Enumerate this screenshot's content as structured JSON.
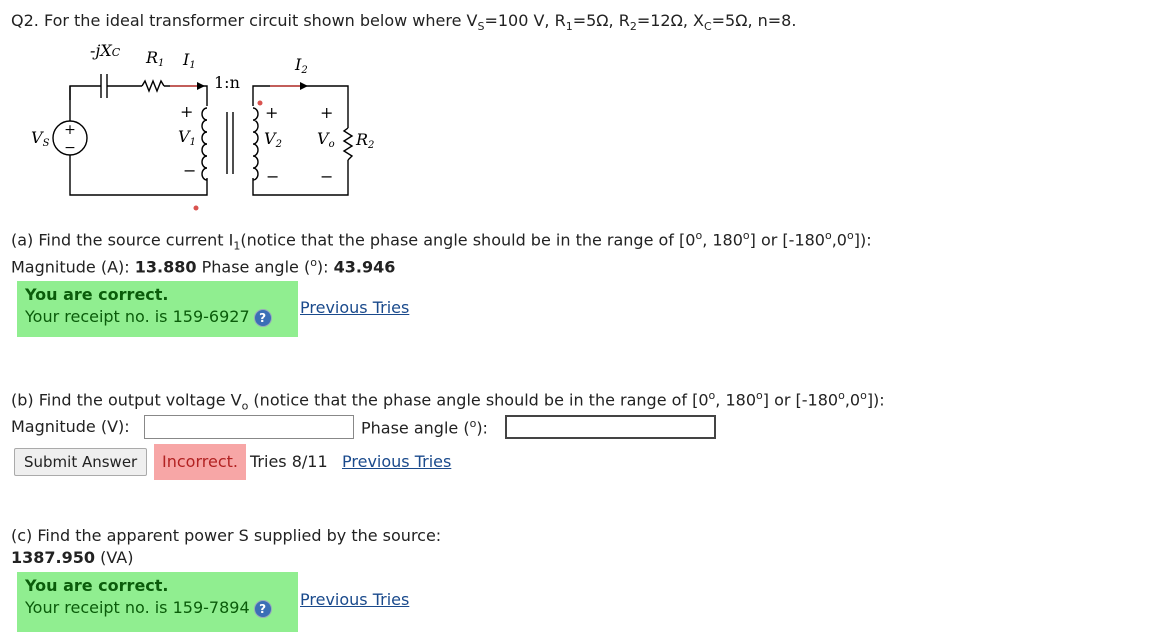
{
  "question": {
    "title": "Q2. For the ideal transformer circuit shown below where V",
    "title_parts": [
      "Q2. For the ideal transformer circuit shown below where V",
      "S",
      "=100 V, R",
      "1",
      "=5Ω, R",
      "2",
      "=12Ω, X",
      "C",
      "=5Ω, n=8."
    ]
  },
  "circuit": {
    "label_jxc": "-jX",
    "label_jxc_sub": "C",
    "label_r1": "R",
    "label_r1_sub": "1",
    "label_i1": "I",
    "label_i1_sub": "1",
    "label_ratio": "1:n",
    "label_i2": "I",
    "label_i2_sub": "2",
    "label_vs": "V",
    "label_vs_sub": "S",
    "label_v1": "V",
    "label_v1_sub": "1",
    "label_v2": "V",
    "label_v2_sub": "2",
    "label_vo": "V",
    "label_vo_sub": "o",
    "label_r2": "R",
    "label_r2_sub": "2",
    "plus": "+",
    "minus": "−"
  },
  "part_a": {
    "prompt_parts": [
      "(a) Find the source current I",
      "1",
      "(notice that the phase angle should be in the range of [0",
      "o",
      ", 180",
      "o",
      "] or [-180",
      "o",
      ",0",
      "o",
      "]):"
    ],
    "magnitude_label": "Magnitude (A): ",
    "magnitude_value": "13.880",
    "phase_label": " Phase angle (",
    "phase_unit_sup": "o",
    "phase_label_end": "): ",
    "phase_value": "43.946",
    "correct_text": "You are correct.",
    "receipt_text": "Your receipt no. is 159-6927",
    "help_icon": "?",
    "previous_tries": "Previous Tries"
  },
  "part_b": {
    "prompt_parts": [
      "(b) Find the output voltage V",
      "o",
      " (notice that the phase angle should be in the range of [0",
      "o",
      ", 180",
      "o",
      "] or [-180",
      "o",
      ",0",
      "o",
      "]):"
    ],
    "magnitude_label": "Magnitude (V):",
    "magnitude_value": "",
    "phase_label": "Phase angle (",
    "phase_unit_sup": "o",
    "phase_label_end": "):",
    "phase_value": "",
    "submit_label": "Submit Answer",
    "incorrect_text": "Incorrect.",
    "tries_text": " Tries 8/11 ",
    "previous_tries": "Previous Tries"
  },
  "part_c": {
    "prompt": "(c) Find the apparent power S supplied by the source:",
    "value": "1387.950",
    "unit": " (VA)",
    "correct_text": "You are correct.",
    "receipt_text": "Your receipt no. is 159-7894",
    "help_icon": "?",
    "previous_tries": "Previous Tries"
  },
  "colors": {
    "correct_bg": "#90ee90",
    "incorrect_bg": "#f7a6a6",
    "link": "#1a4a8c"
  }
}
